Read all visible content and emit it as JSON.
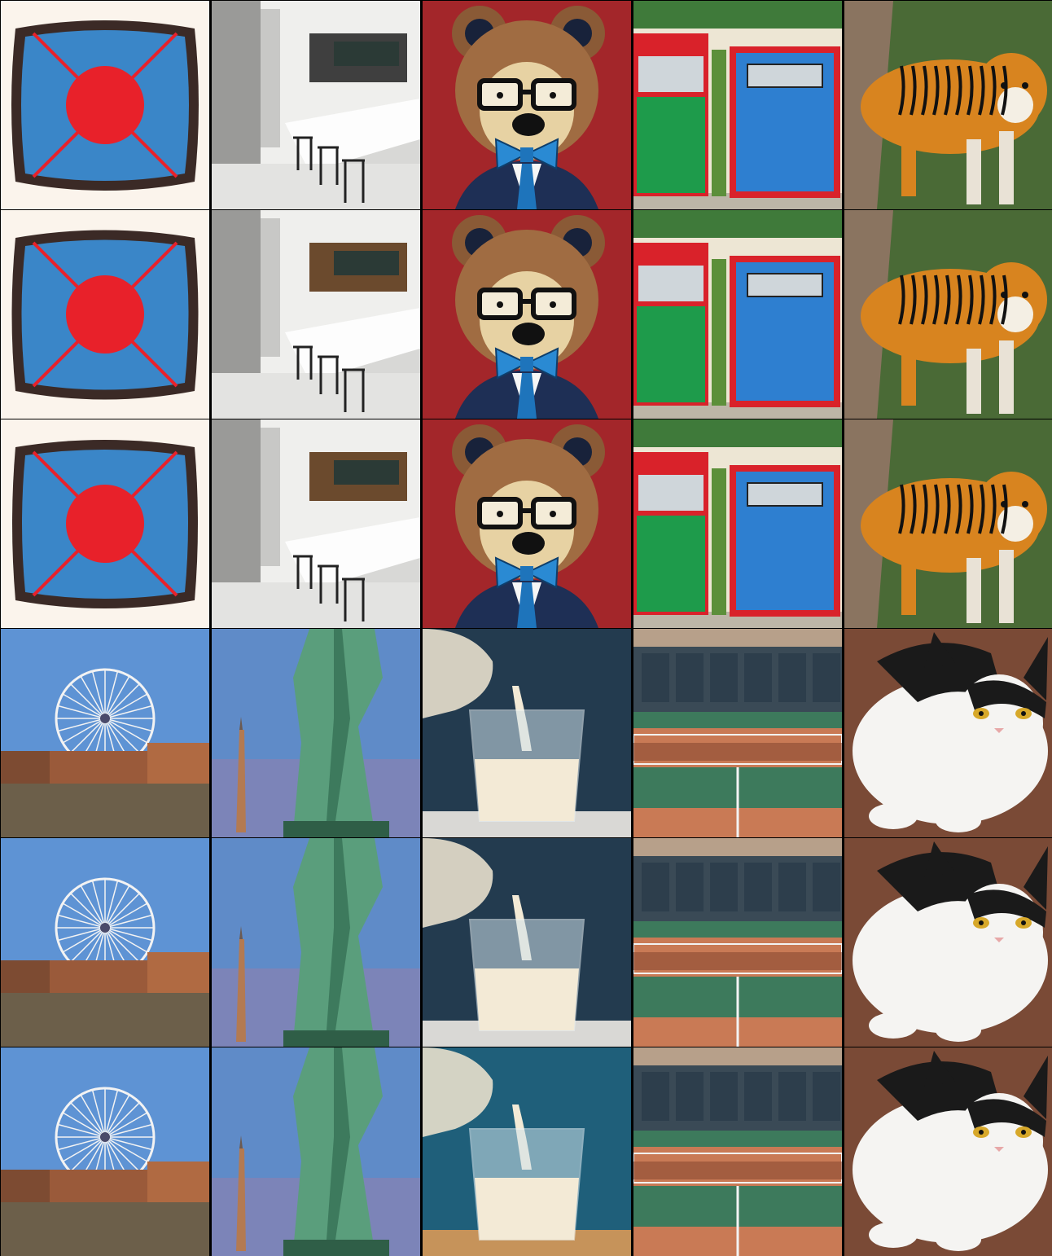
{
  "layout": {
    "columns": 5,
    "rows": 6,
    "row_groups": 2,
    "rows_per_group": 3
  },
  "subjects": [
    {
      "col": 0,
      "group": 0,
      "name": "blue-square-red-circle"
    },
    {
      "col": 1,
      "group": 0,
      "name": "modern-kitchen"
    },
    {
      "col": 2,
      "group": 0,
      "name": "bear-with-glasses-and-bow-tie"
    },
    {
      "col": 3,
      "group": 0,
      "name": "red-green-blue-mailboxes"
    },
    {
      "col": 4,
      "group": 0,
      "name": "tiger"
    },
    {
      "col": 0,
      "group": 1,
      "name": "ferris-wheel-riverside"
    },
    {
      "col": 1,
      "group": 1,
      "name": "statue-of-liberty"
    },
    {
      "col": 2,
      "group": 1,
      "name": "milk-pouring-into-glass"
    },
    {
      "col": 3,
      "group": 1,
      "name": "tennis-court-stadium"
    },
    {
      "col": 4,
      "group": 1,
      "name": "black-white-cat"
    }
  ],
  "colors": {
    "background": "#000000",
    "red": "#e8212a",
    "blue": "#3a86c8",
    "milk": "#f3ead6",
    "liberty_green": "#5a9e7c",
    "tiger_orange": "#d8841f",
    "court_clay": "#c97a55",
    "court_green": "#3d7a5c",
    "bear_bg": "#a3262a"
  }
}
